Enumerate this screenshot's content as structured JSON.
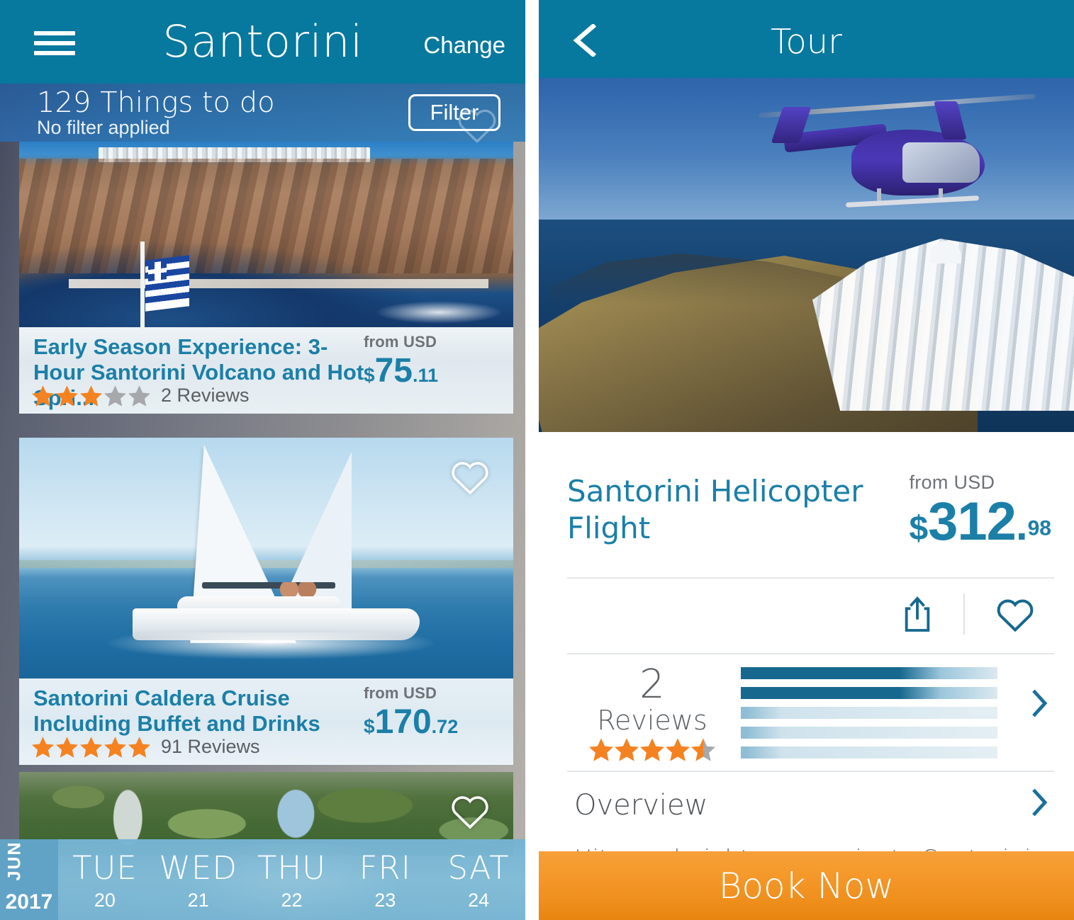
{
  "left": {
    "header": {
      "menu_icon": "hamburger-menu-icon",
      "title": "Santorini",
      "change_label": "Change"
    },
    "subbar": {
      "count_label": "129 Things to do",
      "filter_status": "No filter applied",
      "filter_label": "Filter"
    },
    "cards": [
      {
        "title": "Early Season Experience: 3-Hour Santorini Volcano and Hot Spri...",
        "from_label": "from USD",
        "currency": "$",
        "price": "75",
        "cents": ".11",
        "stars_filled": 3,
        "stars_total": 5,
        "reviews": "2 Reviews",
        "image_alt": "santorini-cliff-greek-flag-photo"
      },
      {
        "title": "Santorini Caldera Cruise Including Buffet and Drinks",
        "from_label": "from USD",
        "currency": "$",
        "price": "170",
        "cents": ".72",
        "stars_filled": 5,
        "stars_total": 5,
        "reviews": "91 Reviews",
        "image_alt": "catamaran-sailing-photo"
      },
      {
        "title": "",
        "image_alt": "greenery-trees-photo"
      }
    ],
    "date_strip": {
      "month": "JUN",
      "year": "2017",
      "days": [
        {
          "name": "TUE",
          "num": "20"
        },
        {
          "name": "WED",
          "num": "21"
        },
        {
          "name": "THU",
          "num": "22"
        },
        {
          "name": "FRI",
          "num": "23"
        },
        {
          "name": "SAT",
          "num": "24"
        }
      ]
    }
  },
  "right": {
    "header": {
      "back_icon": "back-chevron-icon",
      "title": "Tour"
    },
    "hero_image_alt": "helicopter-over-santorini-caldera-photo",
    "product": {
      "title": "Santorini Helicopter Flight",
      "from_label": "from USD",
      "currency": "$",
      "price": "312",
      "dot": ".",
      "cents": "98"
    },
    "actions": {
      "share_icon": "share-icon",
      "favorite_icon": "heart-outline-icon"
    },
    "reviews": {
      "count": "2",
      "word": "Reviews",
      "stars_filled": 4.5,
      "stars_total": 5,
      "bars": [
        100,
        100,
        18,
        18,
        18
      ],
      "chevron_icon": "chevron-right-icon"
    },
    "overview": {
      "label": "Overview",
      "chevron_icon": "chevron-right-icon",
      "description": "Hit new heights on a private Santorini"
    },
    "book": {
      "label": "Book Now"
    }
  },
  "colors": {
    "header_teal": "#07789e",
    "link_blue": "#1b7fa8",
    "star_orange": "#f58220",
    "star_gray": "#a6a8ab",
    "book_orange": "#f19225",
    "bar_fill": "#17688f",
    "bar_track": "#dce9f0"
  }
}
